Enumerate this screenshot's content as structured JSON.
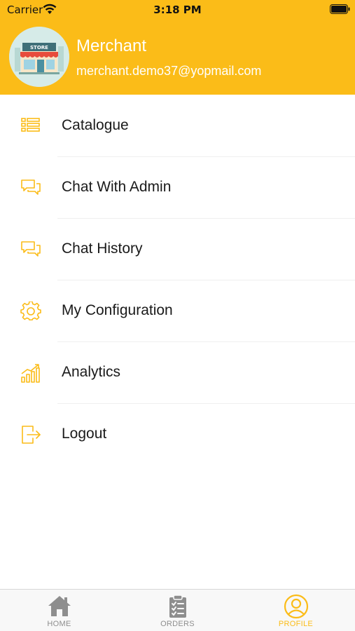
{
  "status_bar": {
    "carrier": "Carrier",
    "time": "3:18 PM"
  },
  "profile": {
    "name": "Merchant",
    "email": "merchant.demo37@yopmail.com",
    "avatar_sign": "STORE"
  },
  "menu": [
    {
      "label": "Catalogue",
      "icon": "list-icon"
    },
    {
      "label": "Chat With Admin",
      "icon": "chat-icon"
    },
    {
      "label": "Chat History",
      "icon": "chat-icon"
    },
    {
      "label": "My Configuration",
      "icon": "gear-icon"
    },
    {
      "label": "Analytics",
      "icon": "analytics-icon"
    },
    {
      "label": "Logout",
      "icon": "logout-icon"
    }
  ],
  "tabbar": {
    "tabs": [
      {
        "label": "HOME",
        "icon": "home-icon",
        "active": false
      },
      {
        "label": "ORDERS",
        "icon": "clipboard-icon",
        "active": false
      },
      {
        "label": "PROFILE",
        "icon": "profile-icon",
        "active": true
      }
    ]
  },
  "colors": {
    "accent": "#fbbc18",
    "icon_inactive": "#8e8e8e",
    "text": "#1a1a1a",
    "header_text": "#ffffff"
  }
}
